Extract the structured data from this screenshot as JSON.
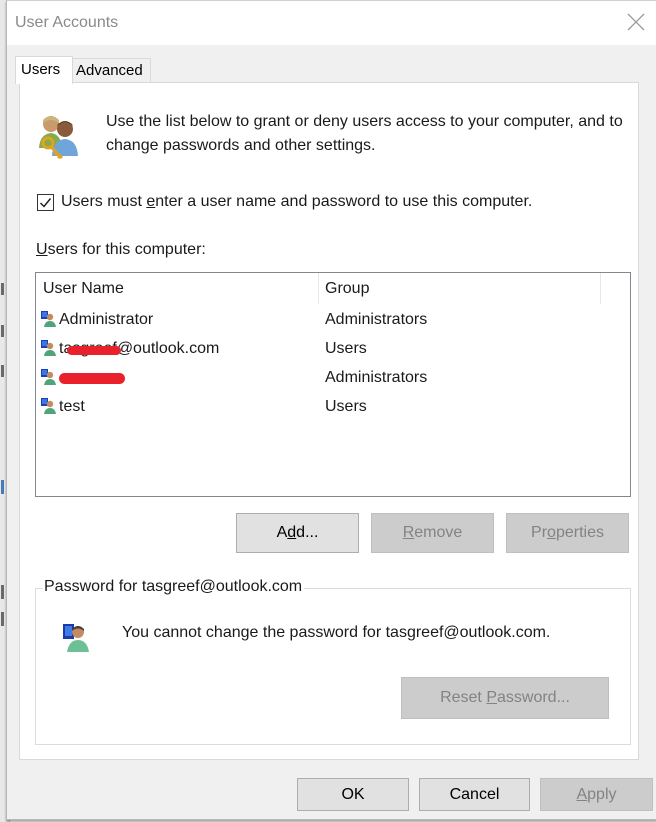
{
  "window": {
    "title": "User Accounts",
    "close_icon": "close-icon"
  },
  "tabs": [
    {
      "label": "Users",
      "active": true
    },
    {
      "label": "Advanced",
      "active": false
    }
  ],
  "intro": {
    "icon": "users-key-icon",
    "text": "Use the list below to grant or deny users access to your computer, and to change passwords and other settings."
  },
  "require_password": {
    "checked": true,
    "label_before": "Users must ",
    "label_accel": "e",
    "label_after": "nter a user name and password to use this computer."
  },
  "users_section": {
    "label_accel": "U",
    "label_rest": "sers for this computer:"
  },
  "user_list": {
    "columns": [
      "User Name",
      "Group"
    ],
    "rows": [
      {
        "name": "Administrator",
        "group": "Administrators",
        "redacted": false
      },
      {
        "name": "tasgreef@outlook.com",
        "group": "Users",
        "redacted": true
      },
      {
        "name": "[redacted]",
        "group": "Administrators",
        "redacted": true
      },
      {
        "name": "test",
        "group": "Users",
        "redacted": false
      }
    ]
  },
  "list_buttons": {
    "add": {
      "pre": "A",
      "accel": "d",
      "post": "d...",
      "enabled": true
    },
    "remove": {
      "pre": "",
      "accel": "R",
      "post": "emove",
      "enabled": false
    },
    "properties": {
      "pre": "Pr",
      "accel": "o",
      "post": "perties",
      "enabled": false
    }
  },
  "password_group": {
    "title": "Password for tasgreef@outlook.com",
    "icon": "user-monitor-icon",
    "message": "You cannot change the password for tasgreef@outlook.com.",
    "reset_button": {
      "pre": "Reset ",
      "accel": "P",
      "post": "assword...",
      "enabled": false
    }
  },
  "footer": {
    "ok": "OK",
    "cancel": "Cancel",
    "apply": {
      "pre": "",
      "accel": "A",
      "post": "pply",
      "enabled": false
    }
  },
  "colors": {
    "window_bg": "#f0f0f0",
    "panel_bg": "#ffffff",
    "button_bg": "#e1e1e1",
    "button_disabled_bg": "#cccccc",
    "disabled_text": "#838383",
    "redaction": "#e8212a"
  }
}
